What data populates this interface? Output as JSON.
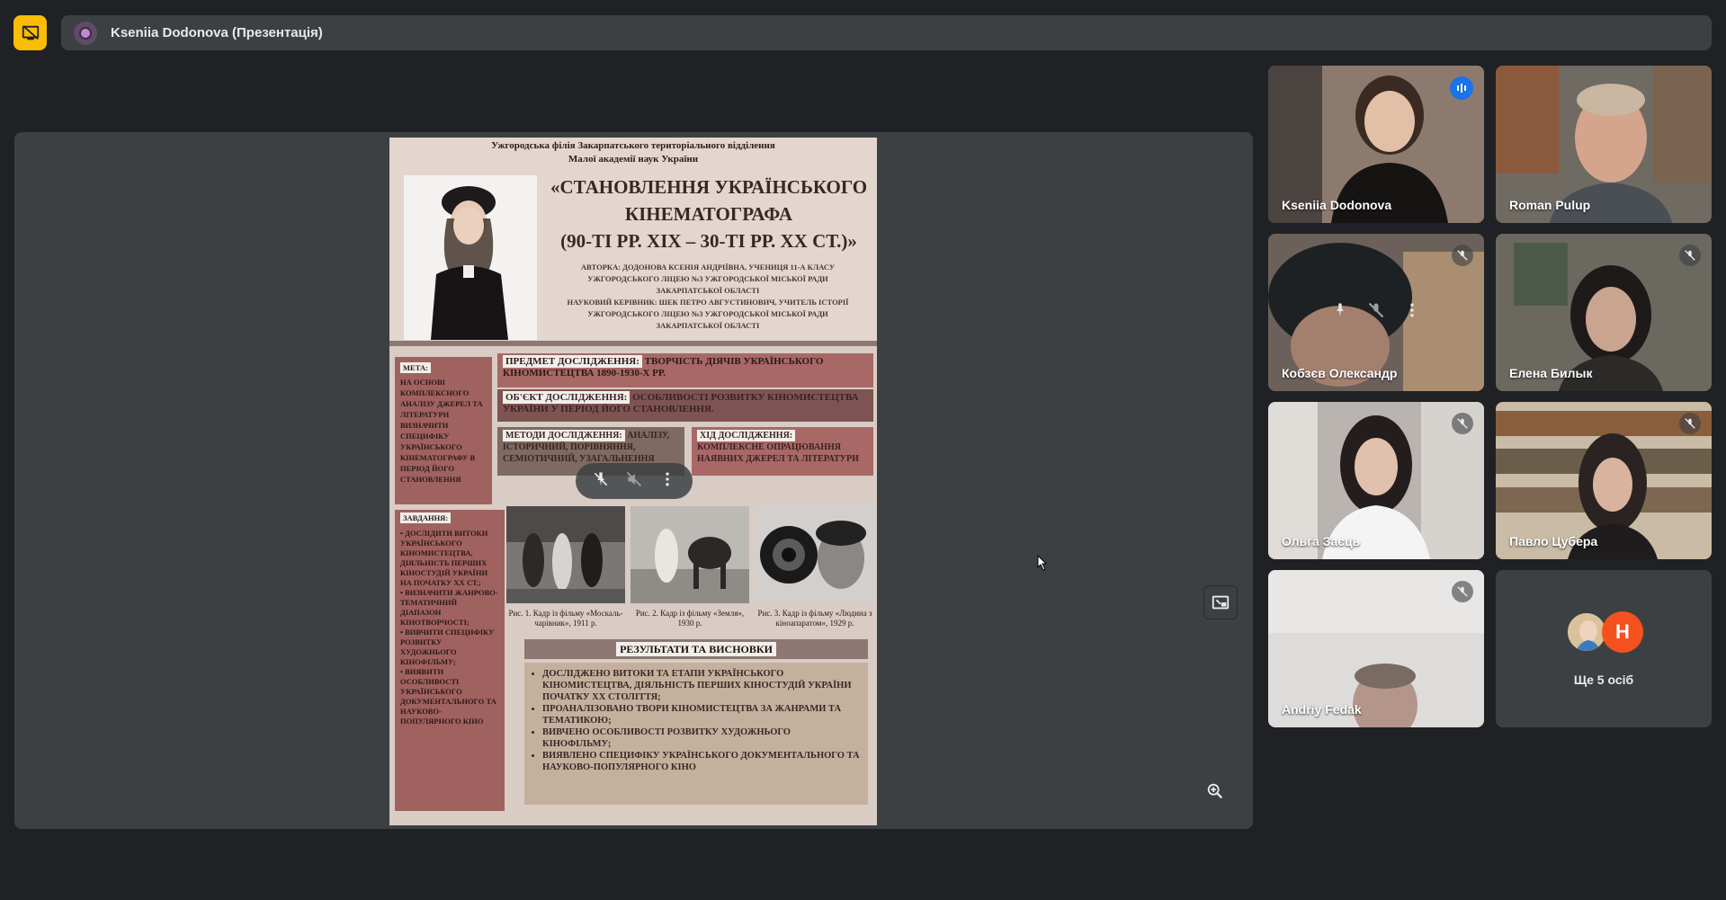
{
  "top_bar": {
    "presenter_title": "Kseniia Dodonova (Презентація)"
  },
  "slide": {
    "org": [
      "Ужгородська філія Закарпатського територіального відділення",
      "Малої академії наук України"
    ],
    "title_lines": [
      "«СТАНОВЛЕННЯ УКРАЇНСЬКОГО",
      "КІНЕМАТОГРАФА",
      "(90-ТІ РР. XIX – 30-ТІ РР. XX СТ.)»"
    ],
    "authors": "АВТОРКА: ДОДОНОВА КСЕНІЯ АНДРІЇВНА, УЧЕНИЦЯ 11-А КЛАСУ УЖГОРОДСЬКОГО ЛІЦЕЮ №3 УЖГОРОДСЬКОЇ МІСЬКОЇ РАДИ ЗАКАРПАТСЬКОЇ ОБЛАСТІ",
    "supervisor": "НАУКОВИЙ КЕРІВНИК: ШЕК ПЕТРО АВГУСТИНОВИЧ, УЧИТЕЛЬ ІСТОРІЇ УЖГОРОДСЬКОГО ЛІЦЕЮ №3 УЖГОРОДСЬКОЇ МІСЬКОЇ РАДИ ЗАКАРПАТСЬКОЇ ОБЛАСТІ",
    "meta_label": "МЕТА:",
    "meta_text": "НА ОСНОВІ КОМПЛЕКСНОГО АНАЛІЗУ ДЖЕРЕЛ ТА ЛІТЕРАТУРИ ВИЗНАЧИТИ СПЕЦИФІКУ УКРАЇНСЬКОГО КІНЕМАТОГРАФУ В ПЕРІОД ЙОГО СТАНОВЛЕННЯ",
    "predmet_label": "ПРЕДМЕТ ДОСЛІДЖЕННЯ:",
    "predmet_text": "ТВОРЧІСТЬ ДІЯЧІВ УКРАЇНСЬКОГО КІНОМИСТЕЦТВА 1890-1930-Х РР.",
    "object_label": "ОБ'ЄКТ ДОСЛІДЖЕННЯ:",
    "object_text": "ОСОБЛИВОСТІ РОЗВИТКУ КІНОМИСТЕЦТВА УКРАЇНИ У ПЕРІОД ЙОГО СТАНОВЛЕННЯ.",
    "methods_label": "МЕТОДИ ДОСЛІДЖЕННЯ:",
    "methods_text": "АНАЛІЗУ, ІСТОРИЧНИЙ, ПОРІВНЯННЯ, СЕМІОТИЧНИЙ, УЗАГАЛЬНЕННЯ",
    "hid_label": "ХІД ДОСЛІДЖЕННЯ:",
    "hid_text": "КОМПЛЕКСНЕ ОПРАЦЮВАННЯ НАЯВНИХ ДЖЕРЕЛ ТА ЛІТЕРАТУРИ",
    "tasks_label": "ЗАВДАННЯ:",
    "tasks": [
      "ДОСЛІДИТИ ВИТОКИ УКРАЇНСЬКОГО КІНОМИСТЕЦТВА, ДІЯЛЬНІСТЬ ПЕРШИХ КІНОСТУДІЙ УКРАЇНИ НА ПОЧАТКУ ХХ СТ.;",
      "ВИЗНАЧИТИ ЖАНРОВО-ТЕМАТИЧНИЙ ДІАПАЗОН КІНОТВОРЧОСТІ;",
      "ВИВЧИТИ СПЕЦИФІКУ РОЗВИТКУ ХУДОЖНЬОГО КІНОФІЛЬМУ;",
      "ВИЯВИТИ ОСОБЛИВОСТІ УКРАЇНСЬКОГО ДОКУМЕНТАЛЬНОГО ТА НАУКОВО-ПОПУЛЯРНОГО КІНО"
    ],
    "captions": [
      "Рис. 1. Кадр із фільму «Москаль-чарівник», 1911 р.",
      "Рис. 2. Кадр із фільму «Земля», 1930 р.",
      "Рис. 3. Кадр із фільму «Людина з кіноапаратом», 1929 р."
    ],
    "results_label": "РЕЗУЛЬТАТИ ТА ВИСНОВКИ",
    "results": [
      "ДОСЛІДЖЕНО ВИТОКИ ТА ЕТАПИ УКРАЇНСЬКОГО КІНОМИСТЕЦТВА, ДІЯЛЬНІСТЬ ПЕРШИХ КІНОСТУДІЙ УКРАЇНИ ПОЧАТКУ ХХ СТОЛІТТЯ;",
      "ПРОАНАЛІЗОВАНО ТВОРИ КІНОМИСТЕЦТВА ЗА ЖАНРАМИ ТА ТЕМАТИКОЮ;",
      "ВИВЧЕНО ОСОБЛИВОСТІ РОЗВИТКУ ХУДОЖНЬОГО КІНОФІЛЬМУ;",
      "ВИЯВЛЕНО СПЕЦИФІКУ УКРАЇНСЬКОГО ДОКУМЕНТАЛЬНОГО ТА НАУКОВО-ПОПУЛЯРНОГО КІНО"
    ]
  },
  "participants": [
    {
      "name": "Kseniia Dodonova",
      "state": "speaking",
      "color": "#8d7a6e"
    },
    {
      "name": "Roman Pulup",
      "state": "none",
      "color": "#6f6a62"
    },
    {
      "name": "Кобзєв Олександр",
      "state": "muted",
      "color": "#4a4442"
    },
    {
      "name": "Елена Билык",
      "state": "muted",
      "color": "#6b6860"
    },
    {
      "name": "Ольга Заєць",
      "state": "muted",
      "color": "#b9b4b0"
    },
    {
      "name": "Павло Цубера",
      "state": "muted",
      "color": "#7b6a58"
    },
    {
      "name": "Andriy Fedak",
      "state": "muted",
      "color": "#cfcdcb"
    }
  ],
  "more_tile": {
    "initial": "H",
    "label": "Ще 5 осіб"
  },
  "icons": {
    "present": "present-off-icon",
    "pip": "picture-in-picture-icon",
    "zoom": "zoom-in-icon",
    "pin": "pin-icon",
    "mic_off": "mic-off-icon",
    "more": "more-vert-icon"
  }
}
